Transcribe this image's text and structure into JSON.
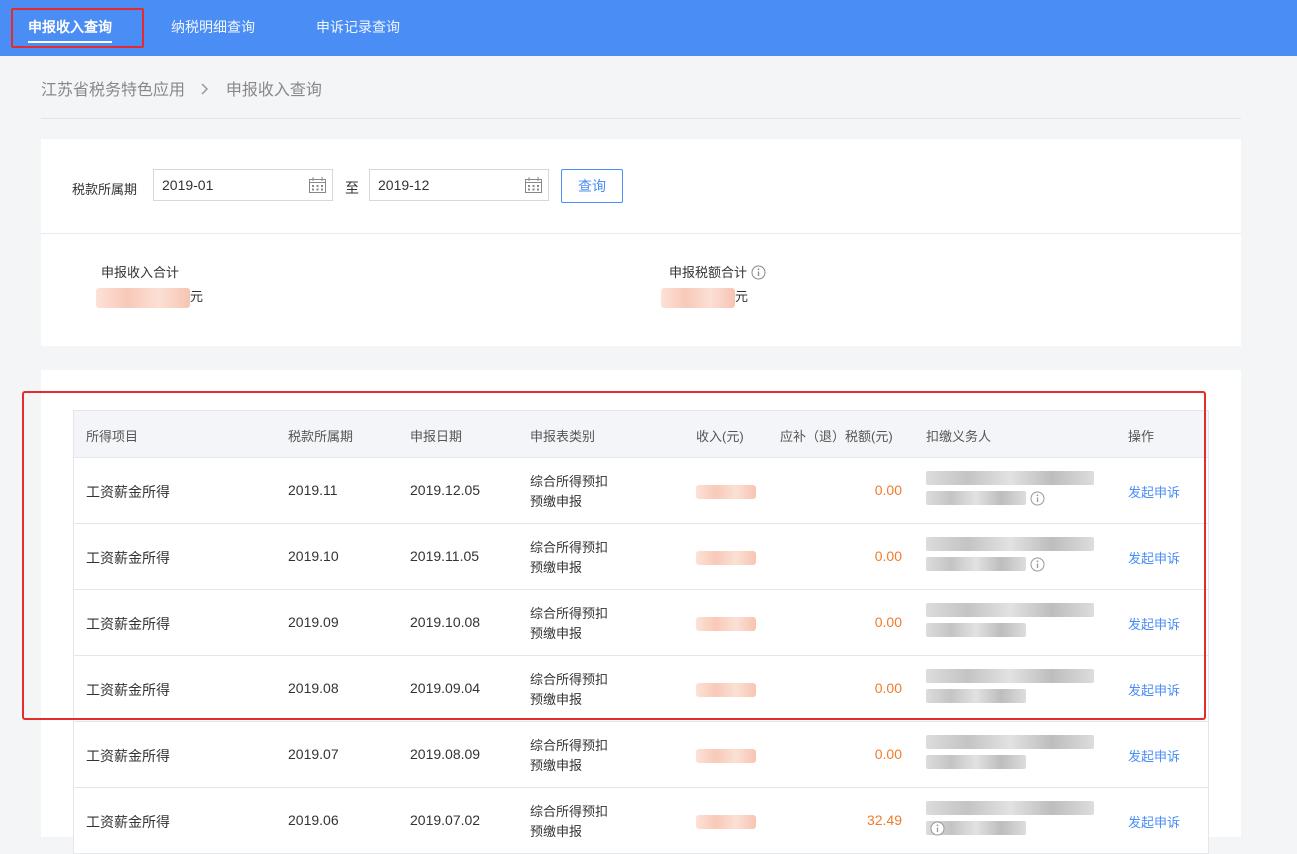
{
  "nav": {
    "tabs": [
      {
        "label": "申报收入查询",
        "active": true
      },
      {
        "label": "纳税明细查询",
        "active": false
      },
      {
        "label": "申诉记录查询",
        "active": false
      }
    ]
  },
  "breadcrumb": {
    "root": "江苏省税务特色应用",
    "current": "申报收入查询"
  },
  "filter": {
    "period_label": "税款所属期",
    "start": "2019-01",
    "to_label": "至",
    "end": "2019-12",
    "query_button": "查询"
  },
  "summary": {
    "income_label": "申报收入合计",
    "income_unit": "元",
    "tax_label": "申报税额合计",
    "tax_unit": "元"
  },
  "table": {
    "headers": [
      "所得项目",
      "税款所属期",
      "申报日期",
      "申报表类别",
      "收入(元)",
      "应补（退）税额(元)",
      "扣缴义务人",
      "操作"
    ],
    "rows": [
      {
        "item": "工资薪金所得",
        "period": "2019.11",
        "date": "2019.12.05",
        "type1": "综合所得预扣",
        "type2": "预缴申报",
        "tax": "0.00",
        "action": "发起申诉"
      },
      {
        "item": "工资薪金所得",
        "period": "2019.10",
        "date": "2019.11.05",
        "type1": "综合所得预扣",
        "type2": "预缴申报",
        "tax": "0.00",
        "action": "发起申诉"
      },
      {
        "item": "工资薪金所得",
        "period": "2019.09",
        "date": "2019.10.08",
        "type1": "综合所得预扣",
        "type2": "预缴申报",
        "tax": "0.00",
        "action": "发起申诉"
      },
      {
        "item": "工资薪金所得",
        "period": "2019.08",
        "date": "2019.09.04",
        "type1": "综合所得预扣",
        "type2": "预缴申报",
        "tax": "0.00",
        "action": "发起申诉"
      },
      {
        "item": "工资薪金所得",
        "period": "2019.07",
        "date": "2019.08.09",
        "type1": "综合所得预扣",
        "type2": "预缴申报",
        "tax": "0.00",
        "action": "发起申诉"
      },
      {
        "item": "工资薪金所得",
        "period": "2019.06",
        "date": "2019.07.02",
        "type1": "综合所得预扣",
        "type2": "预缴申报",
        "tax": "32.49",
        "action": "发起申诉"
      }
    ]
  },
  "colors": {
    "nav_bg": "#4a8df5",
    "highlight": "#e52b2b",
    "link": "#4a8df5",
    "tax_value": "#f07b2d"
  }
}
